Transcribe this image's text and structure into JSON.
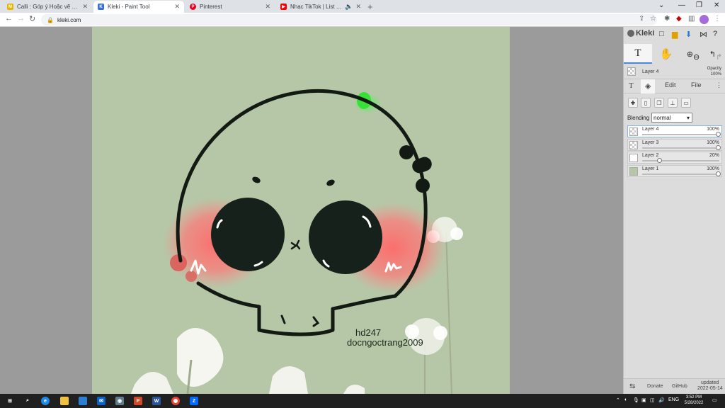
{
  "browser": {
    "tabs": [
      {
        "title": "Calli : Góp ý Hoặc vẽ mầm/anim",
        "favicon_color": "#e8b400"
      },
      {
        "title": "Kleki - Paint Tool",
        "favicon_color": "#3b6fd8",
        "active": true
      },
      {
        "title": "Pinterest",
        "favicon_color": "#e60023"
      },
      {
        "title": "Nhạc TikTok | List nhạc chil",
        "favicon_color": "#ff0000"
      }
    ],
    "url": "kleki.com"
  },
  "artwork": {
    "watermark_line1": "hd247",
    "watermark_line2": "docngoctrang2009"
  },
  "kleki": {
    "app_name": "Kleki",
    "current_layer": {
      "name": "Layer 4",
      "opacity_label": "Opacity",
      "opacity_value": "100%"
    },
    "subtabs": {
      "edit": "Edit",
      "file": "File"
    },
    "blending": {
      "label": "Blending",
      "value": "normal"
    },
    "layers": [
      {
        "name": "Layer 4",
        "opacity": "100%",
        "fraction": 1.0,
        "active": true
      },
      {
        "name": "Layer 3",
        "opacity": "100%",
        "fraction": 1.0
      },
      {
        "name": "Layer 2",
        "opacity": "20%",
        "fraction": 0.2
      },
      {
        "name": "Layer 1",
        "opacity": "100%",
        "fraction": 1.0
      }
    ],
    "footer": {
      "donate": "Donate",
      "github": "GitHub",
      "updated_label": "updated",
      "updated_date": "2022-05-14"
    }
  },
  "taskbar": {
    "lang": "ENG",
    "time": "3:52 PM",
    "date": "5/28/2022"
  }
}
